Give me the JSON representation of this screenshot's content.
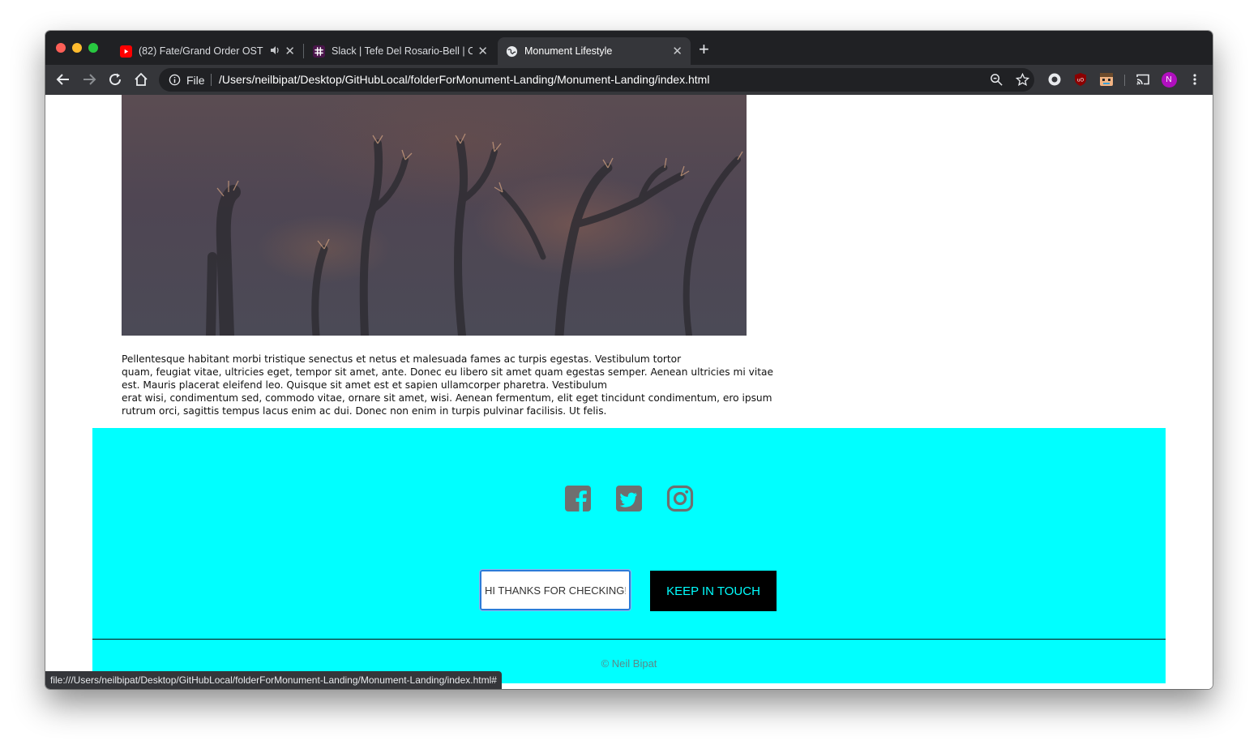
{
  "browser": {
    "tabs": [
      {
        "label": "(82) Fate/Grand Order OST",
        "favicon": "youtube-icon",
        "active": false
      },
      {
        "label": "Slack | Tefe Del Rosario-Bell | C",
        "favicon": "slack-icon",
        "active": false
      },
      {
        "label": "Monument Lifestyle",
        "favicon": "globe-icon",
        "active": true
      }
    ],
    "omnibox": {
      "scheme_label": "File",
      "url": "/Users/neilbipat/Desktop/GitHubLocal/folderForMonument-Landing/Monument-Landing/index.html"
    },
    "profile_initial": "N",
    "status_url": "file:///Users/neilbipat/Desktop/GitHubLocal/folderForMonument-Landing/Monument-Landing/index.html#"
  },
  "page": {
    "paragraph_lines": [
      "Pellentesque habitant morbi tristique senectus et netus et malesuada fames ac turpis egestas. Vestibulum tortor",
      "quam, feugiat vitae, ultricies eget, tempor sit amet, ante. Donec eu libero sit amet quam egestas semper. Aenean ultricies mi vitae",
      "est. Mauris placerat eleifend leo. Quisque sit amet est et sapien ullamcorper pharetra. Vestibulum",
      "erat wisi, condimentum sed, commodo vitae, ornare sit amet, wisi. Aenean fermentum, elit eget tincidunt condimentum, ero ipsum",
      "rutrum orci, sagittis tempus lacus enim ac dui. Donec non enim in turpis pulvinar facilisis. Ut felis."
    ],
    "footer": {
      "social_icons": [
        "facebook-icon",
        "twitter-icon",
        "instagram-icon"
      ],
      "input_value": "HI THANKS FOR CHECKING!",
      "button_label": "KEEP IN TOUCH",
      "copyright": "© Neil Bipat"
    }
  },
  "colors": {
    "footer_bg": "#00ffff",
    "button_bg": "#000000",
    "button_text": "#00ffff",
    "icon_gray": "#6f6f6f"
  }
}
